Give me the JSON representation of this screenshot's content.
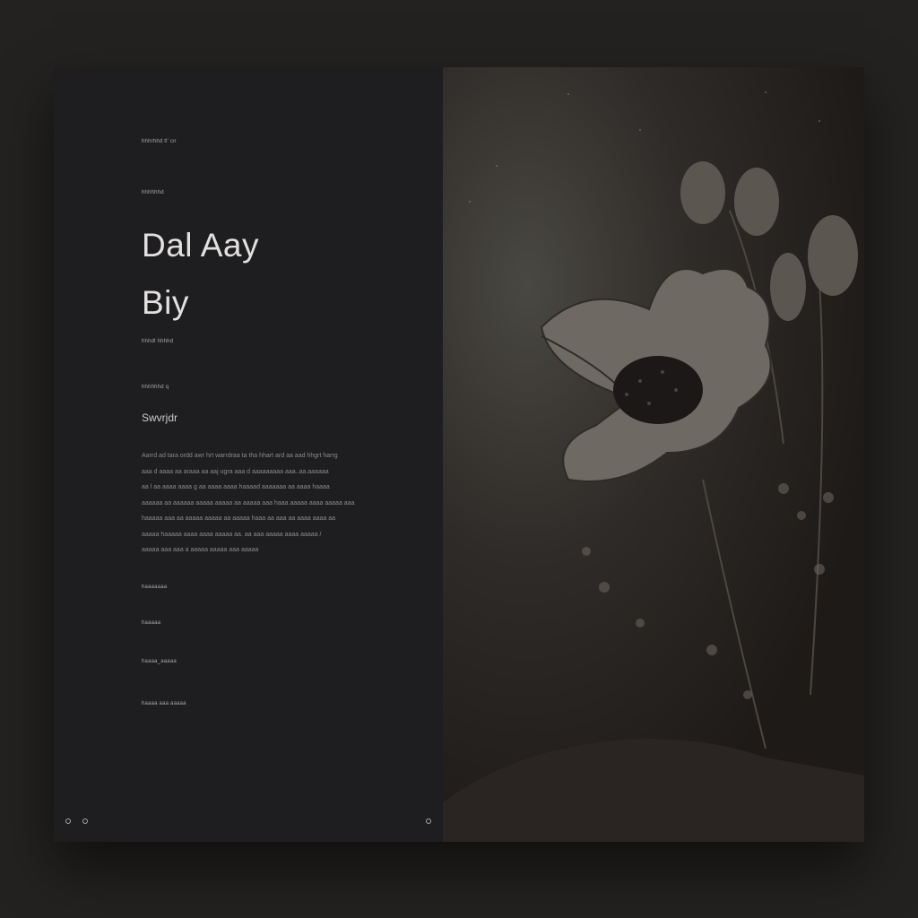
{
  "left_panel": {
    "eyebrow": "hhhrhhd tl' cn",
    "label_1": "hhhhhhd",
    "title_line_1": "Dal Aay",
    "title_line_2": "Biy",
    "label_2": "hhhdl hhhhd",
    "label_3": "hhhhhhd q",
    "subtitle": "Swvrjdr",
    "paragraph": [
      "Aarrd ad tara ordd awr hrt warrdraa ta tha hhart ard aa aad hhgrt harrg",
      "aaa d aaaa aa araaa aa aaj ugra aaa d aaaaaaaaa aaa..aa.aaaaaa",
      "aa l aa aaaa aaaa g aa aaaa aaaa haaaad aaaaaaa aa aaaa haaaa",
      "aaaaaa aa aaaaaa aaaaa aaaaa aa aaaaa aaa haaa aaaaa aaaa aaaaa aaa",
      "haaaaa aaa aa aaaaa aaaaa aa aaaaa haaa aa aaa aa aaaa aaaa aa",
      "aaaaa haaaaa aaaa aaaa aaaaa aa. aa aaa aaaaa aaaa aaaaa /",
      "aaaaa aaa aaa a aaaaa aaaaa aaa aaaaa"
    ],
    "links": [
      "haaaaaaa",
      "haaaaa",
      "haaaa_aaaaa",
      "haaaa aaa aaaaa"
    ]
  },
  "image_panel": {
    "icon": "flower-illustration"
  }
}
